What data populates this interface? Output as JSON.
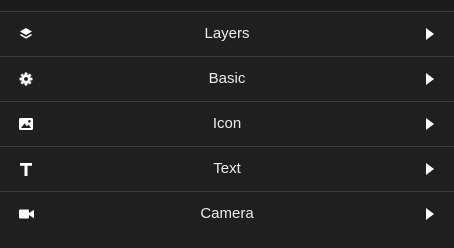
{
  "menu": {
    "items": [
      {
        "label": "Layers",
        "icon": "layers-icon"
      },
      {
        "label": "Basic",
        "icon": "gear-icon"
      },
      {
        "label": "Icon",
        "icon": "image-icon"
      },
      {
        "label": "Text",
        "icon": "text-icon"
      },
      {
        "label": "Camera",
        "icon": "camera-icon"
      }
    ]
  },
  "colors": {
    "background": "#1f1f1f",
    "divider": "#3d3d3d",
    "text": "#eaeaea",
    "icon": "#ffffff"
  }
}
